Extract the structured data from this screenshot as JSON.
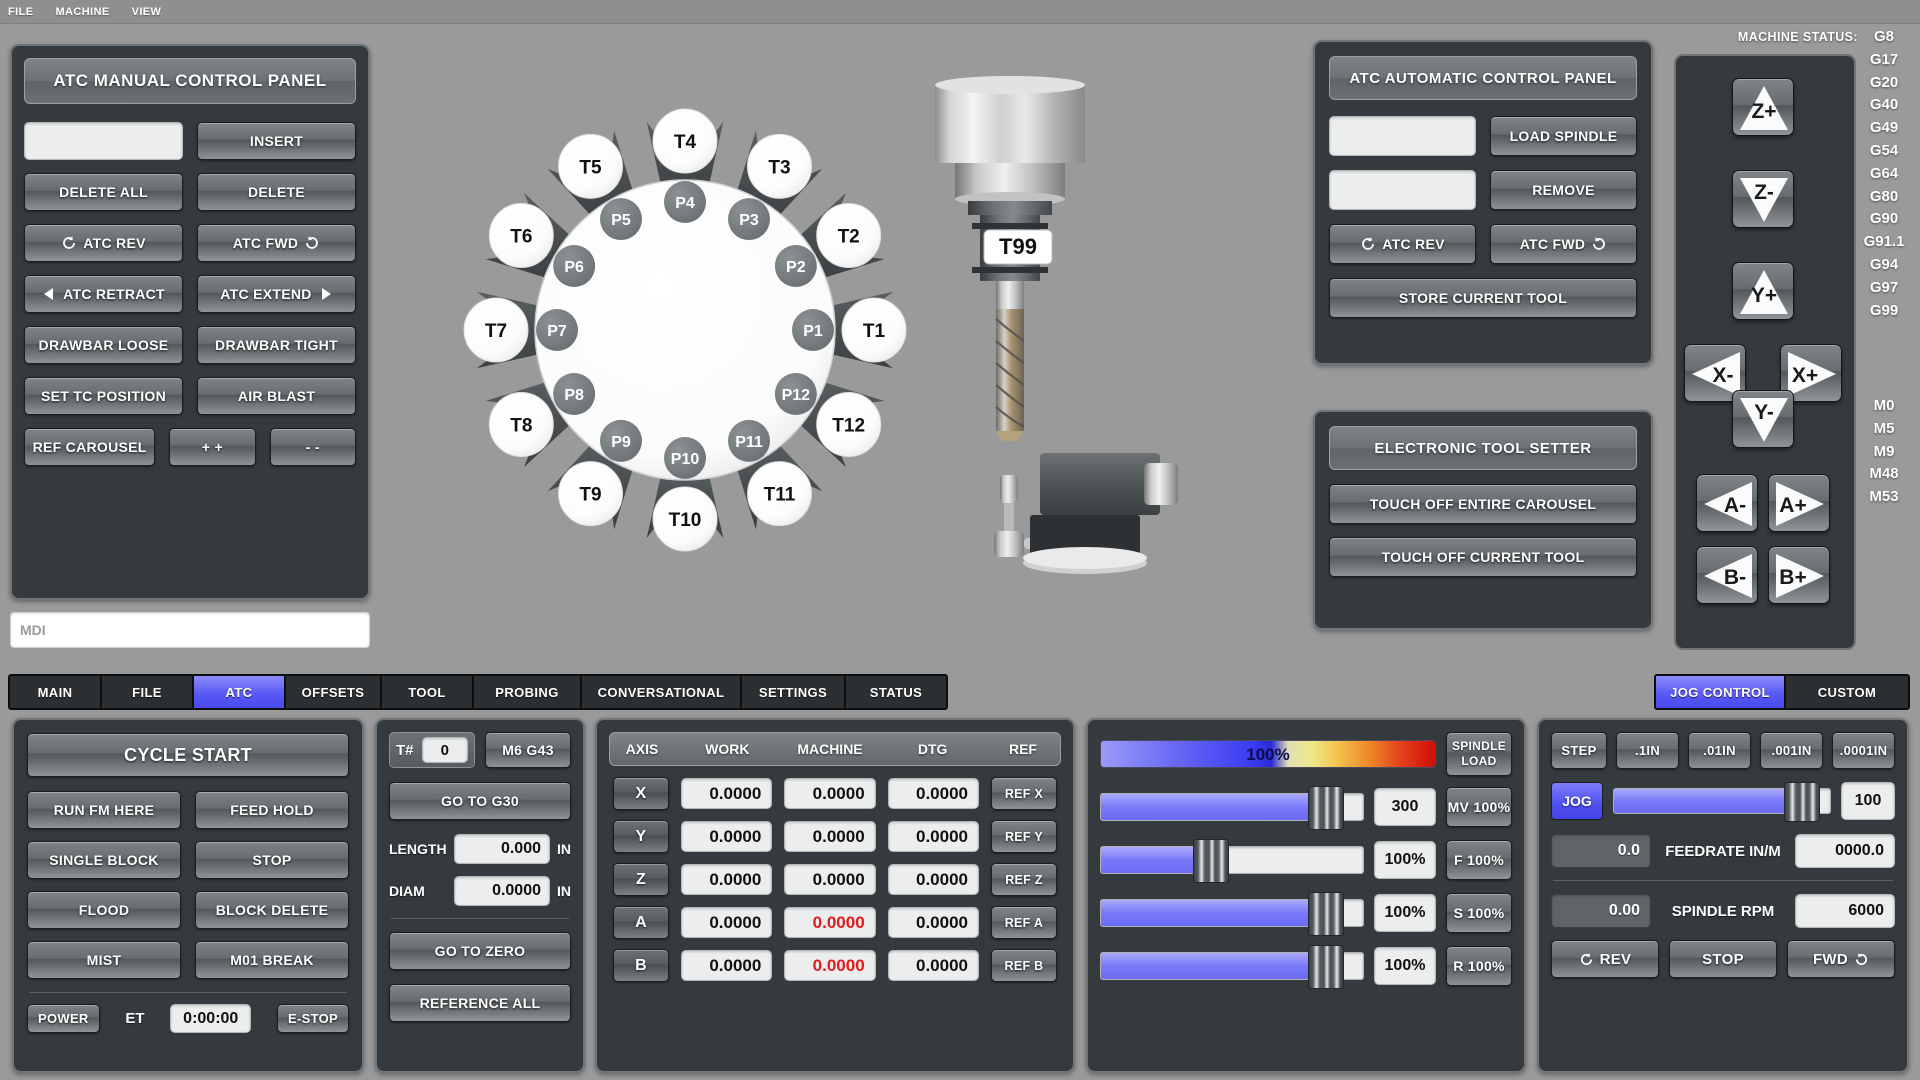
{
  "menubar": {
    "items": [
      "FILE",
      "MACHINE",
      "VIEW"
    ]
  },
  "manual_panel": {
    "title": "ATC MANUAL CONTROL PANEL",
    "tool_input_value": "",
    "buttons": {
      "insert": "INSERT",
      "delete_all": "DELETE ALL",
      "delete": "DELETE",
      "atc_rev": "ATC REV",
      "atc_fwd": "ATC FWD",
      "atc_retract": "ATC RETRACT",
      "atc_extend": "ATC EXTEND",
      "drawbar_loose": "DRAWBAR LOOSE",
      "drawbar_tight": "DRAWBAR TIGHT",
      "set_tc_position": "SET TC POSITION",
      "air_blast": "AIR BLAST",
      "ref_carousel": "REF CAROUSEL",
      "plus": "+ +",
      "minus": "- -"
    }
  },
  "mdi": {
    "placeholder": "MDI",
    "value": ""
  },
  "carousel": {
    "tools": [
      "T1",
      "T2",
      "T3",
      "T4",
      "T5",
      "T6",
      "T7",
      "T8",
      "T9",
      "T10",
      "T11",
      "T12"
    ],
    "pockets": [
      "P1",
      "P2",
      "P3",
      "P4",
      "P5",
      "P6",
      "P7",
      "P8",
      "P9",
      "P10",
      "P11",
      "P12"
    ]
  },
  "spindle_art": {
    "tool_tag": "T99"
  },
  "auto_panel": {
    "title": "ATC AUTOMATIC CONTROL PANEL",
    "load_field_value": "",
    "remove_field_value": "",
    "buttons": {
      "load_spindle": "LOAD SPINDLE",
      "remove": "REMOVE",
      "atc_rev": "ATC REV",
      "atc_fwd": "ATC FWD",
      "store_current_tool": "STORE CURRENT TOOL"
    }
  },
  "setter_panel": {
    "title": "ELECTRONIC TOOL SETTER",
    "buttons": {
      "touch_off_carousel": "TOUCH OFF ENTIRE CAROUSEL",
      "touch_off_current": "TOUCH OFF CURRENT TOOL"
    }
  },
  "machine_status": {
    "label": "MACHINE STATUS:",
    "gcodes": [
      "G8",
      "G17",
      "G20",
      "G40",
      "G49",
      "G54",
      "G64",
      "G80",
      "G90",
      "G91.1",
      "G94",
      "G97",
      "G99"
    ],
    "mcodes": [
      "M0",
      "M5",
      "M9",
      "M48",
      "M53"
    ],
    "jog_buttons": [
      "Z+",
      "Z-",
      "Y+",
      "X-",
      "X+",
      "Y-",
      "A-",
      "A+",
      "B-",
      "B+"
    ]
  },
  "tabs": {
    "left": [
      "MAIN",
      "FILE",
      "ATC",
      "OFFSETS",
      "TOOL",
      "PROBING",
      "CONVERSATIONAL",
      "SETTINGS",
      "STATUS"
    ],
    "left_active": "ATC",
    "right": [
      "JOG CONTROL",
      "CUSTOM"
    ],
    "right_active": "JOG CONTROL",
    "accent_color": "#5a5af5"
  },
  "cycle_panel": {
    "cycle_start": "CYCLE START",
    "buttons": {
      "run_fm_here": "RUN FM HERE",
      "feed_hold": "FEED HOLD",
      "single_block": "SINGLE BLOCK",
      "stop": "STOP",
      "flood": "FLOOD",
      "block_delete": "BLOCK DELETE",
      "mist": "MIST",
      "m01_break": "M01 BREAK"
    },
    "power": "POWER",
    "et_label": "ET",
    "et_value": "0:00:00",
    "estop": "E-STOP"
  },
  "tool_panel": {
    "tnum_label": "T#",
    "tnum_value": "0",
    "m6_g43": "M6 G43",
    "go_to_g30": "GO TO G30",
    "length_label": "LENGTH",
    "length_value": "0.000",
    "length_unit": "IN",
    "diam_label": "DIAM",
    "diam_value": "0.0000",
    "diam_unit": "IN",
    "go_to_zero": "GO TO ZERO",
    "reference_all": "REFERENCE ALL"
  },
  "dro": {
    "headers": [
      "AXIS",
      "WORK",
      "MACHINE",
      "DTG",
      "REF"
    ],
    "rows": [
      {
        "axis": "X",
        "work": "0.0000",
        "machine": "0.0000",
        "machine_alarm": false,
        "dtg": "0.0000",
        "ref": "REF X"
      },
      {
        "axis": "Y",
        "work": "0.0000",
        "machine": "0.0000",
        "machine_alarm": false,
        "dtg": "0.0000",
        "ref": "REF Y"
      },
      {
        "axis": "Z",
        "work": "0.0000",
        "machine": "0.0000",
        "machine_alarm": false,
        "dtg": "0.0000",
        "ref": "REF Z"
      },
      {
        "axis": "A",
        "work": "0.0000",
        "machine": "0.0000",
        "machine_alarm": true,
        "dtg": "0.0000",
        "ref": "REF A"
      },
      {
        "axis": "B",
        "work": "0.0000",
        "machine": "0.0000",
        "machine_alarm": true,
        "dtg": "0.0000",
        "ref": "REF B"
      }
    ],
    "alarm_color": "#e01b1b"
  },
  "overrides": {
    "spindle_load": {
      "percent_label": "100%",
      "button_line1": "SPINDLE",
      "button_line2": "LOAD",
      "fill_percent": 63
    },
    "sliders": [
      {
        "name": "mv",
        "fill_percent": 86,
        "value": "300",
        "button": "MV 100%"
      },
      {
        "name": "f",
        "fill_percent": 42,
        "value": "100%",
        "button": "F 100%"
      },
      {
        "name": "s",
        "fill_percent": 86,
        "value": "100%",
        "button": "S 100%"
      },
      {
        "name": "r",
        "fill_percent": 86,
        "value": "100%",
        "button": "R 100%"
      }
    ]
  },
  "jog_control": {
    "step_label": "STEP",
    "step_options": [
      ".1IN",
      ".01IN",
      ".001IN",
      ".0001IN"
    ],
    "jog_label": "JOG",
    "jog_fill_percent": 87,
    "jog_value": "100",
    "feedrate_actual": "0.0",
    "feedrate_label": "FEEDRATE IN/M",
    "feedrate_target": "0000.0",
    "spindle_actual": "0.00",
    "spindle_label": "SPINDLE RPM",
    "spindle_target": "6000",
    "rev": "REV",
    "stop": "STOP",
    "fwd": "FWD"
  }
}
